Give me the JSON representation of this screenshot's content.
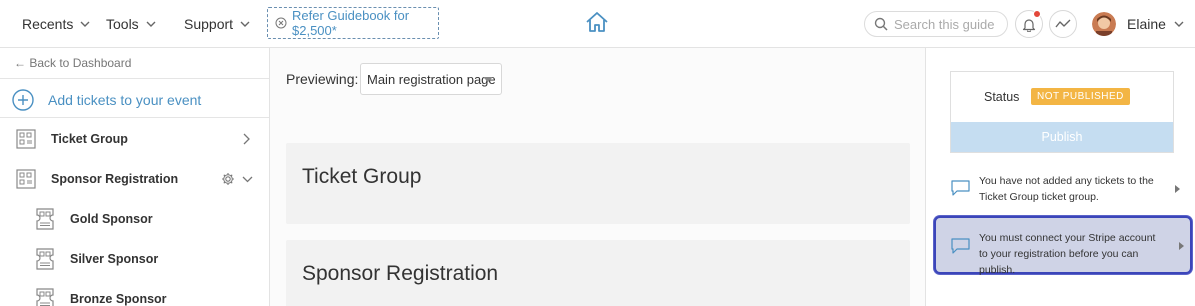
{
  "topbar": {
    "menus": [
      {
        "label": "Recents"
      },
      {
        "label": "Tools"
      },
      {
        "label": "Support"
      }
    ],
    "refer_label": "Refer Guidebook for $2,500*",
    "search_placeholder": "Search this guide",
    "user_name": "Elaine"
  },
  "sidebar": {
    "back_label": "← Back to Dashboard",
    "add_tickets_label": "Add tickets to your event",
    "items": [
      {
        "label": "Ticket Group"
      },
      {
        "label": "Sponsor Registration"
      }
    ],
    "sub_items": [
      {
        "label": "Gold Sponsor"
      },
      {
        "label": "Silver Sponsor"
      },
      {
        "label": "Bronze Sponsor"
      }
    ]
  },
  "main": {
    "preview_label": "Previewing:",
    "preview_value": "Main registration page",
    "sections": [
      {
        "title": "Ticket Group"
      },
      {
        "title": "Sponsor Registration"
      }
    ]
  },
  "right_panel": {
    "status_label": "Status",
    "status_badge": "NOT PUBLISHED",
    "publish_label": "Publish",
    "warnings": [
      {
        "text": "You have not added any tickets to the Ticket Group ticket group."
      },
      {
        "text": "You must connect your Stripe account to your registration before you can publish."
      }
    ]
  },
  "colors": {
    "accent_blue": "#4a90c2",
    "badge_orange": "#f3b544",
    "publish_disabled": "#c5ddf1",
    "highlight_border": "#3b45b9",
    "notification_red": "#e3483a"
  }
}
